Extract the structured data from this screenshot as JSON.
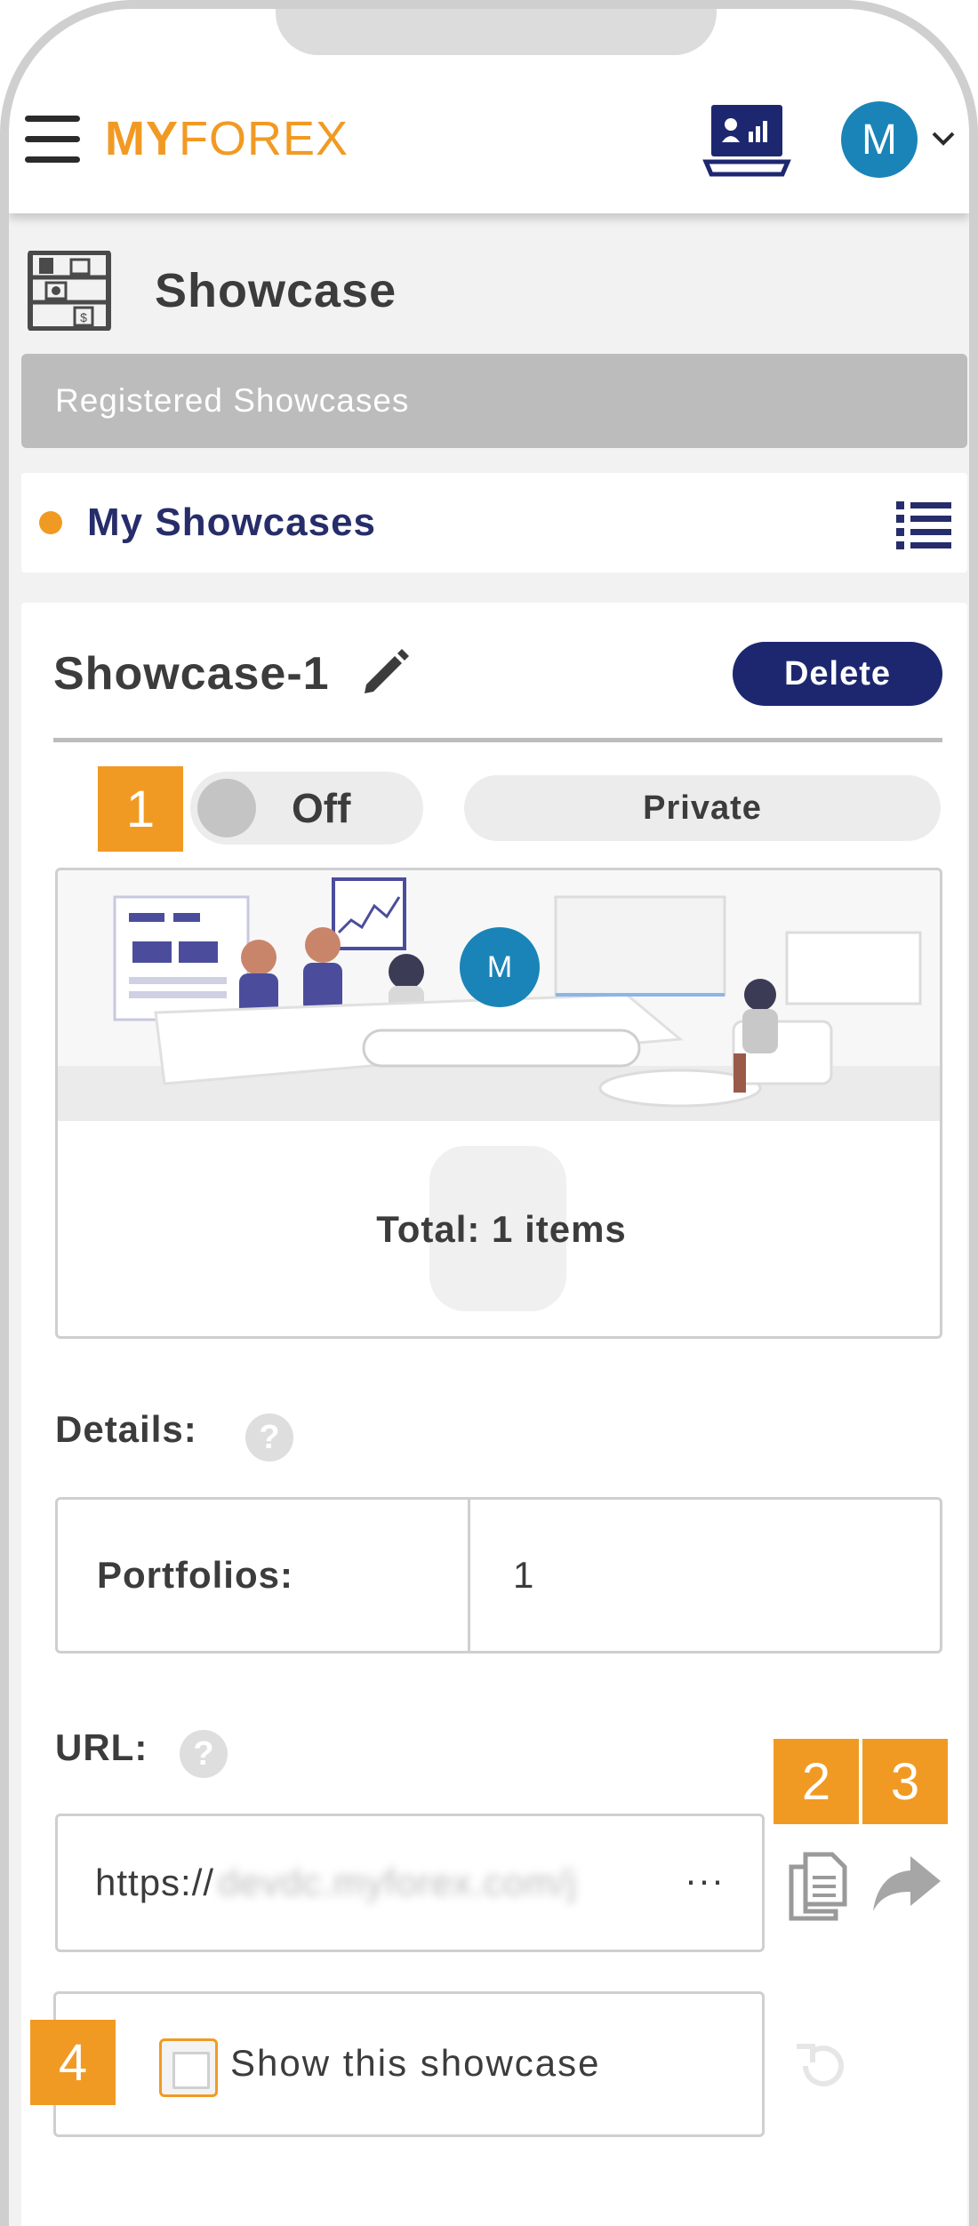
{
  "header": {
    "logo_bold": "MY",
    "logo_rest": "FOREX",
    "avatar_initial": "M",
    "menu_icon": "hamburger-menu-icon",
    "monitor_icon": "desktop-monitor-icon",
    "chevron_icon": "chevron-down-icon"
  },
  "page": {
    "title": "Showcase",
    "title_icon": "showcase-shelf-icon",
    "registered_bar": "Registered Showcases",
    "my_showcases": "My Showcases",
    "list_icon": "list-view-icon"
  },
  "showcase": {
    "name": "Showcase-1",
    "delete_label": "Delete",
    "toggle_state": "Off",
    "visibility": "Private",
    "avatar_initial": "M",
    "total_text": "Total: 1 items",
    "details_label": "Details:",
    "portfolios_key": "Portfolios:",
    "portfolios_value": "1",
    "url_label": "URL:",
    "url_prefix": "https://",
    "url_blurred": "devdc.myforex.com/j",
    "url_ellipsis": "···",
    "show_label": "Show this showcase",
    "show_checked": false
  },
  "badges": {
    "b1": "1",
    "b2": "2",
    "b3": "3",
    "b4": "4"
  },
  "help_glyph": "?",
  "colors": {
    "accent": "#f19a23",
    "navy": "#1d2770",
    "avatar_blue": "#1a84b8",
    "border_gray": "#cfcfcf",
    "bar_gray": "#bcbcbc"
  }
}
